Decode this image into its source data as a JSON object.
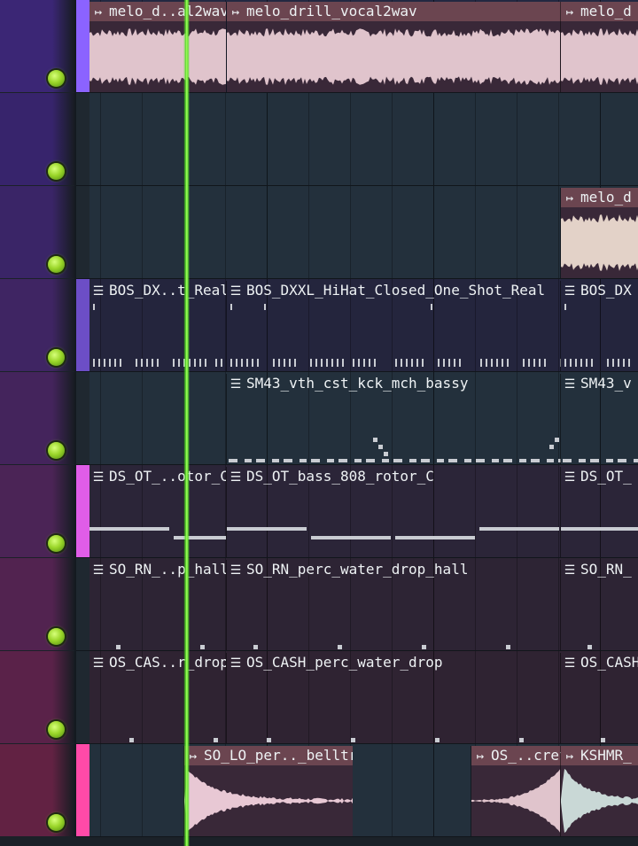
{
  "colors": {
    "playhead": "#5be02a",
    "mute_led": "#9bd62a",
    "audio_clip_title": "#6b4550",
    "pattern_clip_title": "#414d57"
  },
  "icons": {
    "audio_clip": "audio-clip-icon",
    "pattern_clip": "pattern-clip-icon",
    "mute": "mute-led-icon"
  },
  "tracks": [
    {
      "header_color": "#3b2675",
      "lane_color": "#232841",
      "strip_color": "#8b63ff",
      "clips": [
        {
          "type": "audio",
          "name": "melo_d..al2wav",
          "start": 0,
          "end": 154,
          "wave": "full"
        },
        {
          "type": "audio",
          "name": "melo_drill_vocal2wav",
          "start": 154,
          "end": 531,
          "wave": "full"
        },
        {
          "type": "audio",
          "name": "melo_d",
          "start": 531,
          "end": 640,
          "wave": "full"
        }
      ]
    },
    {
      "header_color": "#37246c",
      "lane_color": "#23303c",
      "strip_color": "",
      "clips": []
    },
    {
      "header_color": "#3a2567",
      "lane_color": "#23303c",
      "strip_color": "",
      "clips": [
        {
          "type": "audio",
          "name": "melo_d",
          "start": 531,
          "end": 640,
          "wave": "full"
        }
      ]
    },
    {
      "header_color": "#3f2563",
      "lane_color": "#24253d",
      "strip_color": "#6c4ec6",
      "clips": [
        {
          "type": "pattern",
          "name": "BOS_DX..t_Real",
          "start": 0,
          "end": 154,
          "notes": "hats"
        },
        {
          "type": "pattern",
          "name": "BOS_DXXL_HiHat_Closed_One_Shot_Real",
          "start": 154,
          "end": 531,
          "notes": "hats"
        },
        {
          "type": "pattern",
          "name": "BOS_DX",
          "start": 531,
          "end": 640,
          "notes": "hats"
        }
      ]
    },
    {
      "header_color": "#44245c",
      "lane_color": "#23303c",
      "strip_color": "",
      "clips": [
        {
          "type": "pattern",
          "name": "SM43_vth_cst_kck_mch_bassy",
          "start": 154,
          "end": 531,
          "notes": "kick"
        },
        {
          "type": "pattern",
          "name": "SM43_v",
          "start": 531,
          "end": 640,
          "notes": "kick"
        }
      ]
    },
    {
      "header_color": "#4b2456",
      "lane_color": "#2b2538",
      "strip_color": "#e05de8",
      "clips": [
        {
          "type": "pattern",
          "name": "DS_OT_..otor_C",
          "start": 0,
          "end": 154,
          "notes": "bass"
        },
        {
          "type": "pattern",
          "name": "DS_OT_bass_808_rotor_C",
          "start": 154,
          "end": 531,
          "notes": "bass"
        },
        {
          "type": "pattern",
          "name": "DS_OT_",
          "start": 531,
          "end": 640,
          "notes": "bass"
        }
      ]
    },
    {
      "header_color": "#522350",
      "lane_color": "#2d2434",
      "strip_color": "",
      "clips": [
        {
          "type": "pattern",
          "name": "SO_RN_..p_hall",
          "start": 0,
          "end": 154,
          "notes": "sparse"
        },
        {
          "type": "pattern",
          "name": "SO_RN_perc_water_drop_hall",
          "start": 154,
          "end": 531,
          "notes": "sparse"
        },
        {
          "type": "pattern",
          "name": "SO_RN_",
          "start": 531,
          "end": 640,
          "notes": "sparse"
        }
      ]
    },
    {
      "header_color": "#5a2249",
      "lane_color": "#2f2332",
      "strip_color": "",
      "clips": [
        {
          "type": "pattern",
          "name": "OS_CAS..r_drop",
          "start": 0,
          "end": 154,
          "notes": "sparse2"
        },
        {
          "type": "pattern",
          "name": "OS_CASH_perc_water_drop",
          "start": 154,
          "end": 531,
          "notes": "sparse2"
        },
        {
          "type": "pattern",
          "name": "OS_CASH",
          "start": 531,
          "end": 640,
          "notes": "sparse2"
        }
      ]
    },
    {
      "header_color": "#622243",
      "lane_color": "#23303c",
      "strip_color": "#ff4aa8",
      "clips": [
        {
          "type": "audio",
          "name": "SO_LO_per.._belltree",
          "start": 106,
          "end": 296,
          "wave": "bell"
        },
        {
          "type": "audio",
          "name": "OS_..cret",
          "start": 430,
          "end": 531,
          "wave": "rise"
        },
        {
          "type": "audio",
          "name": "KSHMR_",
          "start": 531,
          "end": 640,
          "wave": "bell2"
        }
      ]
    }
  ]
}
